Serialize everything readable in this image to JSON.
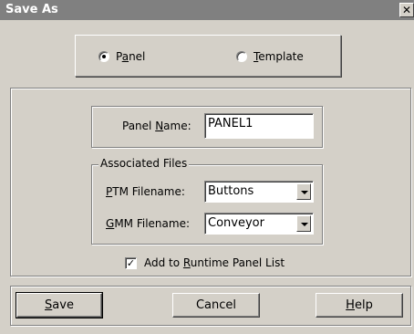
{
  "window": {
    "title": "Save As",
    "close_glyph": "✕"
  },
  "type_selector": {
    "options": [
      {
        "pre": "P",
        "mnemonic": "a",
        "post": "nel",
        "selected": true
      },
      {
        "pre": "",
        "mnemonic": "T",
        "post": "emplate",
        "selected": false
      }
    ]
  },
  "panel_name": {
    "label_pre": "Panel ",
    "label_mnemonic": "N",
    "label_post": "ame:",
    "value": "PANEL1"
  },
  "associated_files": {
    "group_label": "Associated Files",
    "ptm": {
      "label_pre": "",
      "label_mnemonic": "P",
      "label_post": "TM Filename:",
      "value": "Buttons"
    },
    "gmm": {
      "label_pre": "",
      "label_mnemonic": "G",
      "label_post": "MM Filename:",
      "value": "Conveyor"
    }
  },
  "runtime_checkbox": {
    "checked_glyph": "✓",
    "label_pre": "Add to ",
    "label_mnemonic": "R",
    "label_post": "untime Panel List"
  },
  "buttons": {
    "save": {
      "pre": "",
      "mnemonic": "S",
      "post": "ave"
    },
    "cancel": {
      "pre": "Cancel",
      "mnemonic": "",
      "post": ""
    },
    "help": {
      "pre": "",
      "mnemonic": "H",
      "post": "elp"
    }
  }
}
